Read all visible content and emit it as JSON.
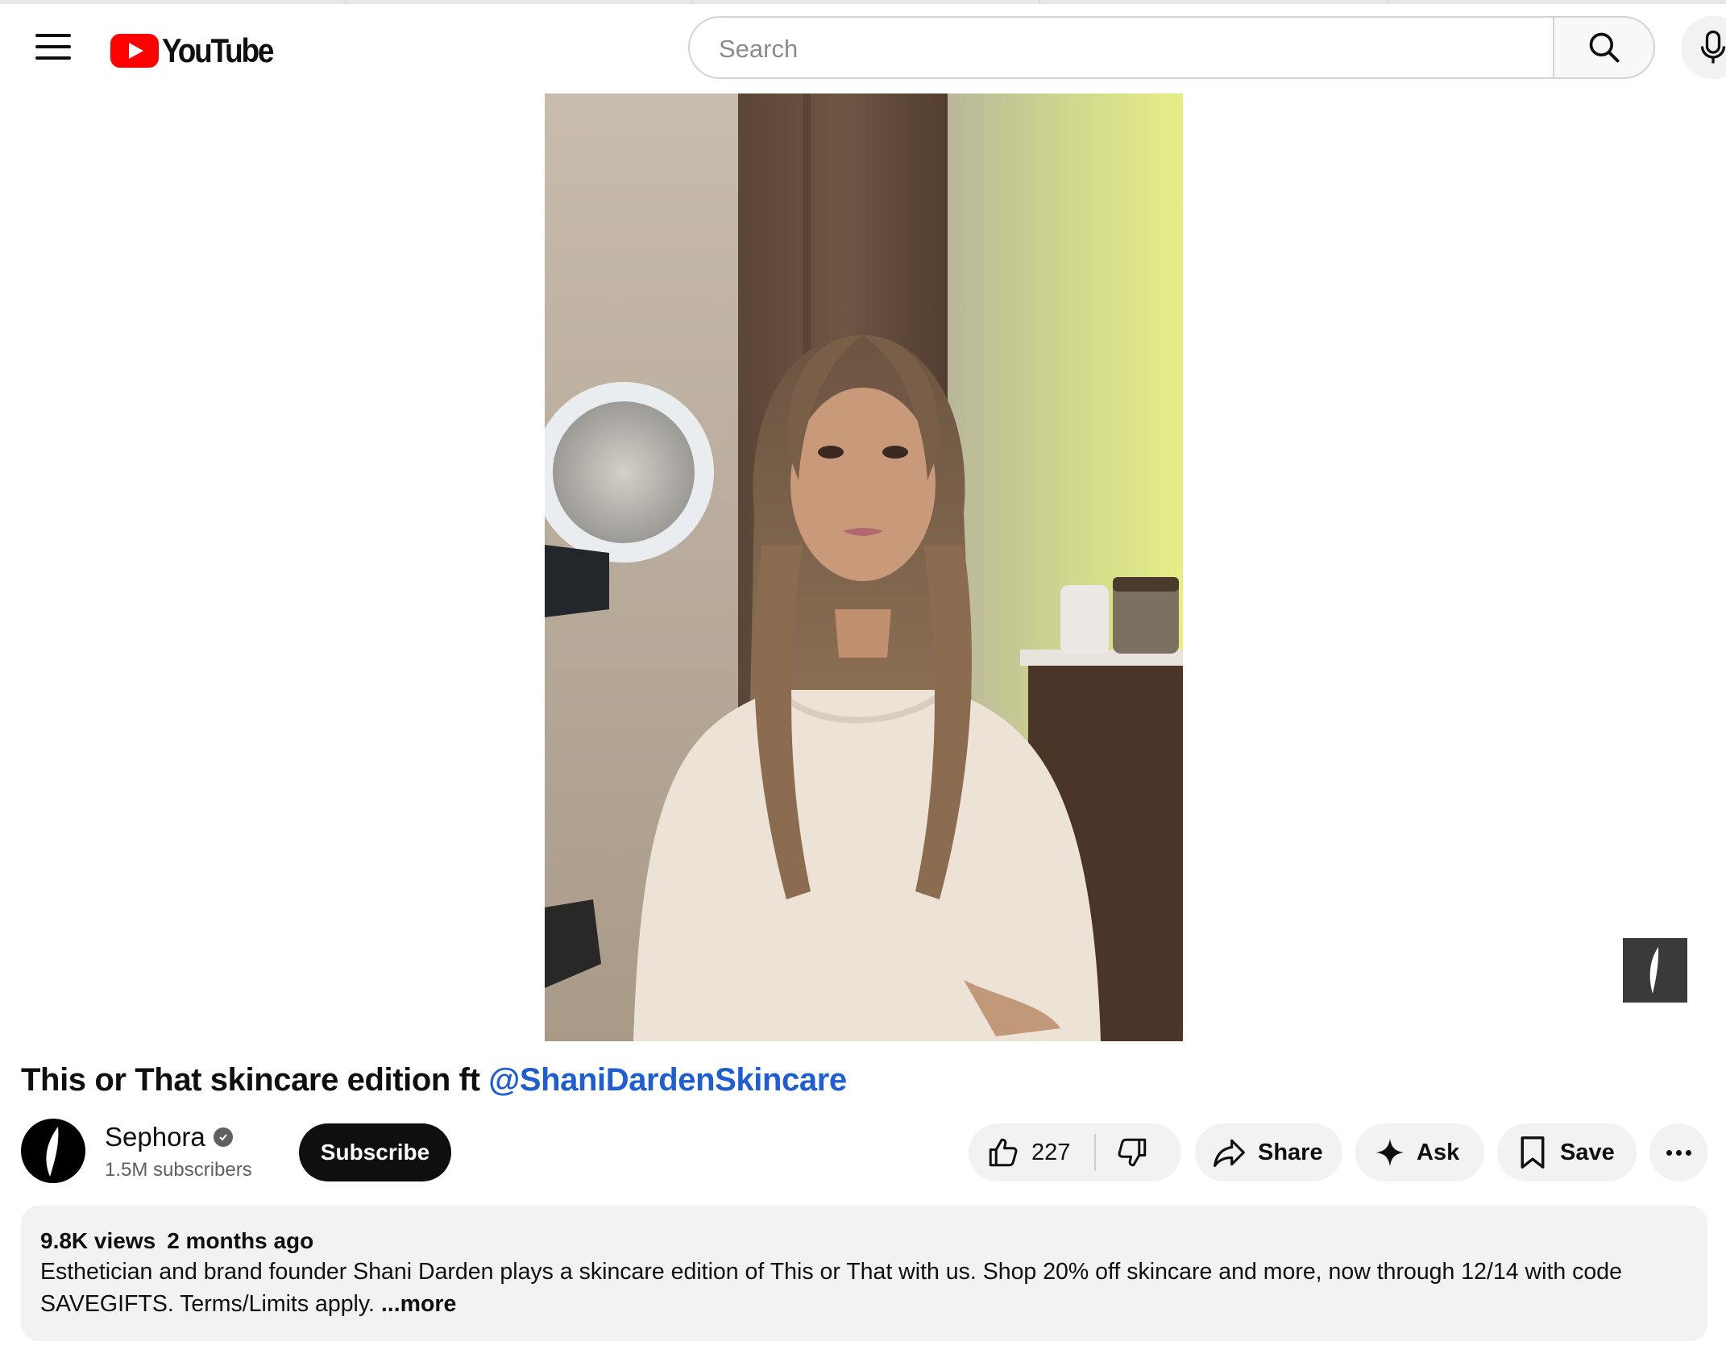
{
  "header": {
    "logo_text": "YouTube",
    "search_placeholder": "Search",
    "icons": [
      "menu-icon",
      "youtube-logo",
      "search-icon",
      "mic-icon"
    ]
  },
  "video": {
    "title_prefix": "This or That skincare edition ft ",
    "title_mention": "@ShaniDardenSkincare"
  },
  "channel": {
    "name": "Sephora",
    "subscribers": "1.5M subscribers",
    "subscribe_label": "Subscribe"
  },
  "actions": {
    "like_count": "227",
    "share_label": "Share",
    "ask_label": "Ask",
    "save_label": "Save",
    "icons": [
      "thumbs-up-icon",
      "thumbs-down-icon",
      "share-icon",
      "sparkle-icon",
      "bookmark-icon",
      "more-icon"
    ]
  },
  "description": {
    "views": "9.8K views",
    "age": "2 months ago",
    "text": "Esthetician and brand founder Shani Darden plays a skincare edition of This or That with us. Shop 20% off skincare and more, now through 12/14 with code SAVEGIFTS. Terms/Limits apply.",
    "more_label": "...more"
  },
  "colors": {
    "brand_red": "#ff0000",
    "mention_blue": "#1e5ed2",
    "pill_bg": "#f2f2f2",
    "subscribe_bg": "#0f0f0f"
  }
}
